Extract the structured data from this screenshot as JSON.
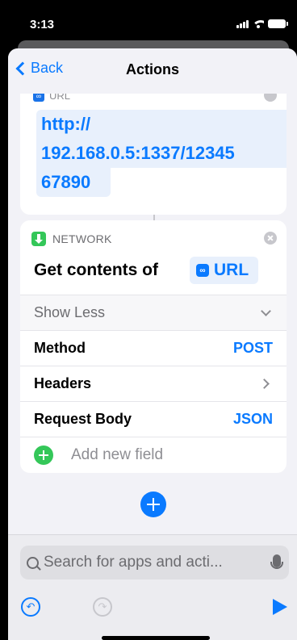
{
  "status": {
    "time": "3:13"
  },
  "nav": {
    "back_label": "Back",
    "title": "Actions"
  },
  "url_action": {
    "header_label": "URL",
    "lines": [
      "http://",
      "192.168.0.5:1337/12345",
      "67890"
    ]
  },
  "network_action": {
    "category": "NETWORK",
    "verb": "Get contents of",
    "token": "URL",
    "show_less": "Show Less",
    "rows": {
      "method": {
        "label": "Method",
        "value": "POST"
      },
      "headers": {
        "label": "Headers"
      },
      "body": {
        "label": "Request Body",
        "value": "JSON"
      }
    },
    "add_field": "Add new field"
  },
  "search": {
    "placeholder": "Search for apps and acti..."
  },
  "colors": {
    "accent": "#0a7aff",
    "green": "#34c759",
    "background": "#f2f2f7"
  },
  "icons": [
    "back-chevron-icon",
    "link-icon",
    "download-icon",
    "close-icon",
    "chevron-down-icon",
    "chevron-right-icon",
    "plus-icon",
    "search-icon",
    "microphone-icon",
    "undo-icon",
    "redo-icon",
    "play-icon"
  ]
}
